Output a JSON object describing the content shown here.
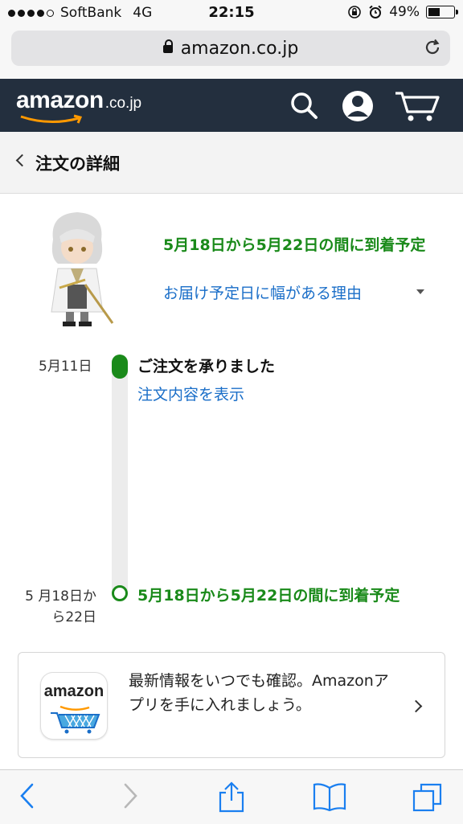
{
  "status_bar": {
    "carrier": "SoftBank",
    "network": "4G",
    "time": "22:15",
    "battery_percent": "49%",
    "signal_dots_filled": 4
  },
  "browser": {
    "url": "amazon.co.jp"
  },
  "header": {
    "logo_word": "amazon",
    "logo_tld": ".co.jp"
  },
  "page": {
    "title": "注文の詳細"
  },
  "order": {
    "arrival_text": "5月18日から5月22日の間に到着予定",
    "reason_link": "お届け予定日に幅がある理由"
  },
  "timeline": [
    {
      "date": "5月11日",
      "status": "ご注文を承りました",
      "link": "注文内容を表示"
    },
    {
      "date": "5 月18日から22日",
      "status": "5月18日から5月22日の間に到着予定"
    }
  ],
  "app_promo": {
    "icon_word": "amazon",
    "text": "最新情報をいつでも確認。Amazonアプリを手に入れましょう。"
  },
  "colors": {
    "header_bg": "#232f3e",
    "accent_green": "#1a8a1a",
    "link_blue": "#1a6ec8",
    "ios_blue": "#1a7ff0",
    "smile_orange": "#ff9900"
  }
}
